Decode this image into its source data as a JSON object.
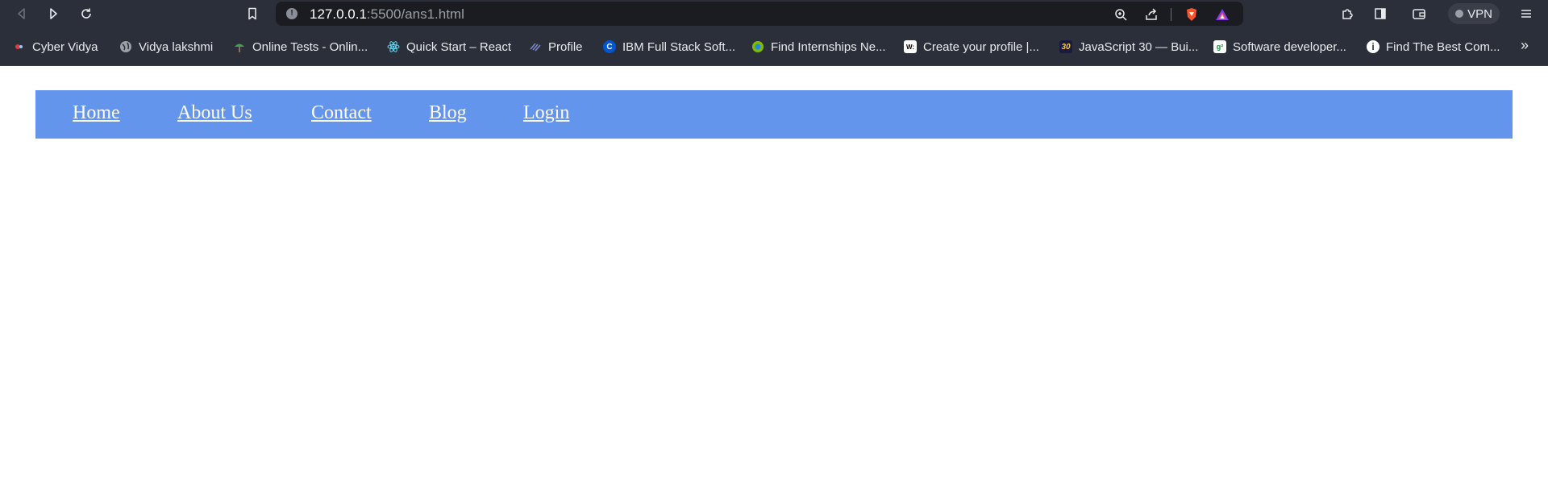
{
  "browser": {
    "url_host": "127.0.0.1",
    "url_path": ":5500/ans1.html",
    "vpn_label": "VPN",
    "toolbar_icons": [
      "back-icon",
      "forward-icon",
      "reload-icon",
      "bookmark-icon",
      "info-icon",
      "zoom-icon",
      "share-icon",
      "brave-shield-icon",
      "brave-rewards-icon",
      "extensions-icon",
      "sidebar-icon",
      "wallet-icon",
      "menu-icon"
    ]
  },
  "bookmarks": [
    {
      "label": "Cyber Vidya",
      "icon": "cyber-vidya-icon",
      "color": "#2b2f3a"
    },
    {
      "label": "Vidya lakshmi",
      "icon": "globe-icon",
      "color": "#5f6368"
    },
    {
      "label": "Online Tests - Onlin...",
      "icon": "tree-icon",
      "color": "#3a7d44"
    },
    {
      "label": "Quick Start – React",
      "icon": "react-icon",
      "color": "#2b2f3a"
    },
    {
      "label": "Profile",
      "icon": "profile-icon",
      "color": "#2b2f3a"
    },
    {
      "label": "IBM Full Stack Soft...",
      "icon": "coursera-icon",
      "color": "#0056d2"
    },
    {
      "label": "Find Internships Ne...",
      "icon": "internshala-icon",
      "color": "#7fba00"
    },
    {
      "label": "Create your profile |...",
      "icon": "wellfound-icon",
      "color": "#ffffff"
    },
    {
      "label": "JavaScript 30 — Bui...",
      "icon": "js30-icon",
      "color": "#1a1a40"
    },
    {
      "label": "Software developer...",
      "icon": "naukri-icon",
      "color": "#ffffff"
    },
    {
      "label": "Find The Best Com...",
      "icon": "info-circle-icon",
      "color": "#ffffff"
    }
  ],
  "nav": {
    "items": [
      {
        "label": "Home"
      },
      {
        "label": "About Us"
      },
      {
        "label": "Contact"
      },
      {
        "label": "Blog"
      },
      {
        "label": "Login"
      }
    ],
    "background": "#6495ed"
  }
}
